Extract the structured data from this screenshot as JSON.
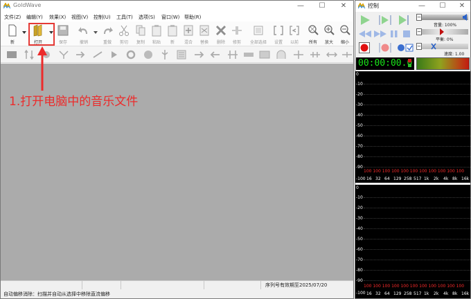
{
  "main_window": {
    "title": "GoldWave",
    "controls": {
      "minimize": "—",
      "maximize": "☐",
      "close": "✕"
    }
  },
  "menu": [
    {
      "label": "文件(Z)"
    },
    {
      "label": "编辑(Y)"
    },
    {
      "label": "效果(X)"
    },
    {
      "label": "视图(V)"
    },
    {
      "label": "控制(U)"
    },
    {
      "label": "工具(T)"
    },
    {
      "label": "选项(S)"
    },
    {
      "label": "窗口(W)"
    },
    {
      "label": "帮助(R)"
    }
  ],
  "toolbar": {
    "new": "新",
    "open": "打开",
    "save": "保存",
    "undo": "撤销",
    "redo": "重做",
    "cut": "剪切",
    "copy": "复制",
    "paste": "粘贴",
    "new2": "新",
    "mix": "混合",
    "replace": "替换",
    "delete": "删除",
    "trim": "修剪",
    "select_all": "全部选择",
    "set": "设置",
    "prev": "以前",
    "all": "所有",
    "zoom_in": "放大",
    "zoom_out": "缩小"
  },
  "annotation": "1.打开电脑中的音乐文件",
  "status": {
    "serial": "序列号有效期至2025/07/20",
    "message": "自动偏移消除：扫描并自动从选择中移除直流偏移"
  },
  "control_window": {
    "title": "控制",
    "volume_label": "音量: 100%",
    "balance_label": "平衡: 0%",
    "speed_label": "速度: 1.00",
    "timer": "00:00:00.0",
    "scope_y_labels": [
      "0",
      "-10",
      "-20",
      "-30",
      "-40",
      "-50",
      "-60",
      "-70",
      "-80",
      "-90",
      "-100"
    ],
    "scope_x_labels": [
      "16",
      "32",
      "64",
      "129",
      "258",
      "517",
      "1k",
      "2k",
      "4k",
      "8k",
      "16k"
    ],
    "red_row": "100 100 100 100 100 100 100 100 100 100 100",
    "colors": {
      "timer_text": "#19e619",
      "scope_red": "#ff2b2b",
      "annotation": "#ec2b2b"
    }
  }
}
